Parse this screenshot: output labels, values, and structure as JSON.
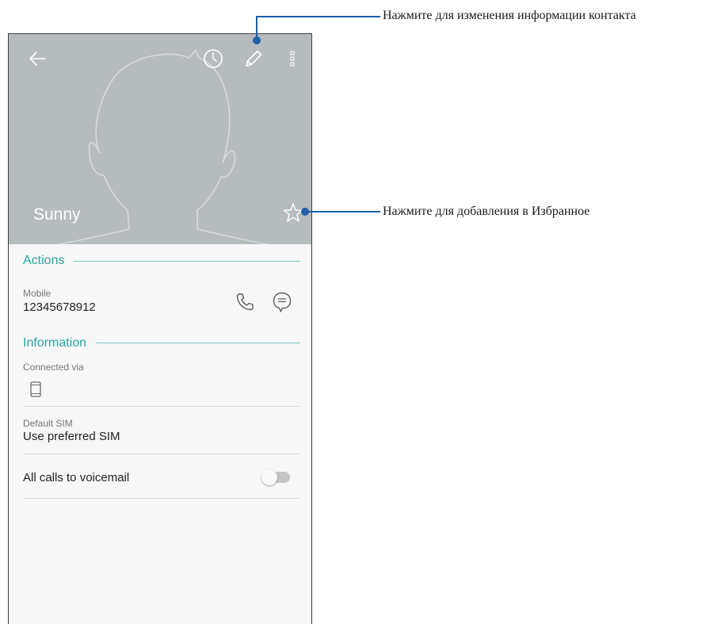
{
  "contact": {
    "name": "Sunny"
  },
  "header": {
    "icons": {
      "back": "arrow-left-icon",
      "history": "clock-icon",
      "edit": "pencil-icon",
      "more": "more-vertical-icon",
      "favorite": "star-outline-icon"
    }
  },
  "actions": {
    "title": "Actions",
    "phone_label": "Mobile",
    "phone_number": "12345678912",
    "icons": {
      "call": "phone-icon",
      "message": "message-bubble-icon"
    }
  },
  "information": {
    "title": "Information",
    "connected_label": "Connected via",
    "connected_icon": "phone-device-icon",
    "default_sim_label": "Default SIM",
    "default_sim_value": "Use preferred SIM",
    "voicemail_label": "All calls to voicemail",
    "voicemail_enabled": false
  },
  "callouts": {
    "edit": "Нажмите для изменения информации контакта",
    "favorite": "Нажмите для добавления в Избранное"
  },
  "colors": {
    "header_bg": "#b6bbbe",
    "accent_teal": "#2ba3a0",
    "callout_blue": "#1e5fa8",
    "screen_bg": "#f7f7f7"
  }
}
